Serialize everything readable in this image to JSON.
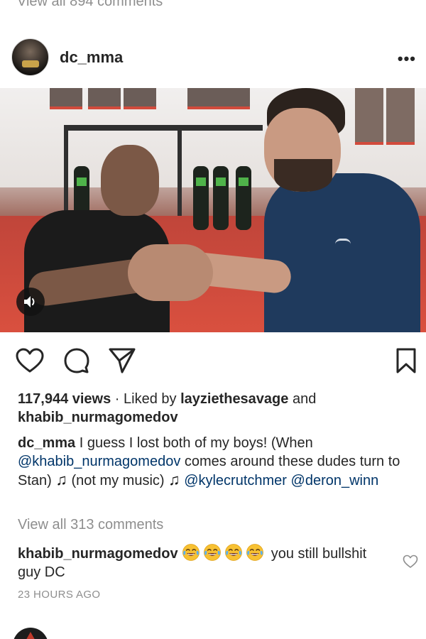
{
  "previous_post": {
    "view_all_comments": "View all 894 comments"
  },
  "post": {
    "username": "dc_mma",
    "more_icon": "more-horizontal-icon",
    "audio_icon": "speaker-icon",
    "actions": {
      "like_icon": "heart-icon",
      "comment_icon": "comment-icon",
      "share_icon": "send-icon",
      "save_icon": "bookmark-icon"
    },
    "views": "117,944 views",
    "liked_by_prefix": "· Liked by",
    "liked_by_user1": "layziethesavage",
    "liked_by_and": "and",
    "liked_by_user2": "khabib_nurmagomedov",
    "caption": {
      "author": "dc_mma",
      "text1": "I guess I lost both of my boys! (When",
      "mention1": "@khabib_nurmagomedov",
      "text2": "comes around these dudes turn to Stan)",
      "note1": "♫",
      "text3": "(not my music)",
      "note2": "♫",
      "mention2": "@kylecrutchmer",
      "mention3": "@deron_winn"
    },
    "view_all_comments": "View all 313 comments",
    "top_comment": {
      "author": "khabib_nurmagomedov",
      "emoji_name": "face-with-tears-of-joy",
      "emoji_count": 4,
      "text": "you still bullshit guy DC"
    },
    "timestamp": "23 HOURS AGO"
  },
  "colors": {
    "text": "#262626",
    "muted": "#8e8e8e",
    "mention": "#003569"
  }
}
